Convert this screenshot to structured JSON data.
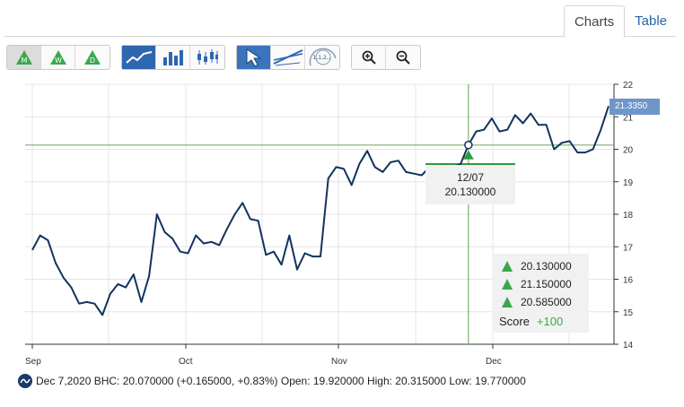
{
  "tabs": [
    {
      "label": "Charts"
    },
    {
      "label": "Table"
    }
  ],
  "toolbar": {
    "period_buttons": [
      {
        "letter": "M"
      },
      {
        "letter": "W"
      },
      {
        "letter": "D"
      }
    ],
    "icons": [
      "monthly-signal-icon",
      "weekly-signal-icon",
      "daily-signal-icon",
      "line-chart-icon",
      "bar-chart-icon",
      "candlestick-icon",
      "cursor-icon",
      "trendline-icon",
      "fibonacci-icon",
      "zoom-in-icon",
      "zoom-out-icon"
    ]
  },
  "hover": {
    "date": "12/07",
    "value": "20.130000"
  },
  "current_price": "21.3350",
  "score_panel": {
    "m_value": "20.130000",
    "w_value": "21.150000",
    "d_value": "20.585000",
    "score_label": "Score",
    "score_value": "+100"
  },
  "info_line": "Dec 7,2020 BHC: 20.070000 (+0.165000, +0.83%) Open: 19.920000 High: 20.315000 Low: 19.770000",
  "colors": {
    "line": "#12335e",
    "crosshair": "#7cb26b",
    "signal": "#2e9b3f",
    "tab_link": "#2a64a6"
  },
  "chart_data": {
    "type": "line",
    "x_tick_labels": [
      "Sep",
      "Oct",
      "Nov",
      "Dec"
    ],
    "y_ticks": [
      14,
      15,
      16,
      17,
      18,
      19,
      20,
      21,
      22
    ],
    "ylim": [
      14,
      22
    ],
    "grid": true,
    "series": [
      {
        "values": [
          16.9,
          17.35,
          17.2,
          16.5,
          16.05,
          15.75,
          15.25,
          15.3,
          15.25,
          14.9,
          15.55,
          15.85,
          15.75,
          16.15,
          15.3,
          16.1,
          18.0,
          17.45,
          17.25,
          16.85,
          16.8,
          17.35,
          17.1,
          17.15,
          17.05,
          17.55,
          18.0,
          18.35,
          17.85,
          17.8,
          16.75,
          16.85,
          16.45,
          17.35,
          16.3,
          16.8,
          16.7,
          16.7,
          19.1,
          19.45,
          19.4,
          18.9,
          19.55,
          19.95,
          19.45,
          19.3,
          19.6,
          19.65,
          19.3,
          19.25,
          19.2,
          19.45,
          19.45,
          19.5,
          19.45,
          19.55,
          20.13,
          20.55,
          20.6,
          20.95,
          20.55,
          20.6,
          21.05,
          20.8,
          21.1,
          20.75,
          20.75,
          20.0,
          20.2,
          20.25,
          19.9,
          19.9,
          20.0,
          20.6,
          21.33
        ]
      }
    ]
  }
}
